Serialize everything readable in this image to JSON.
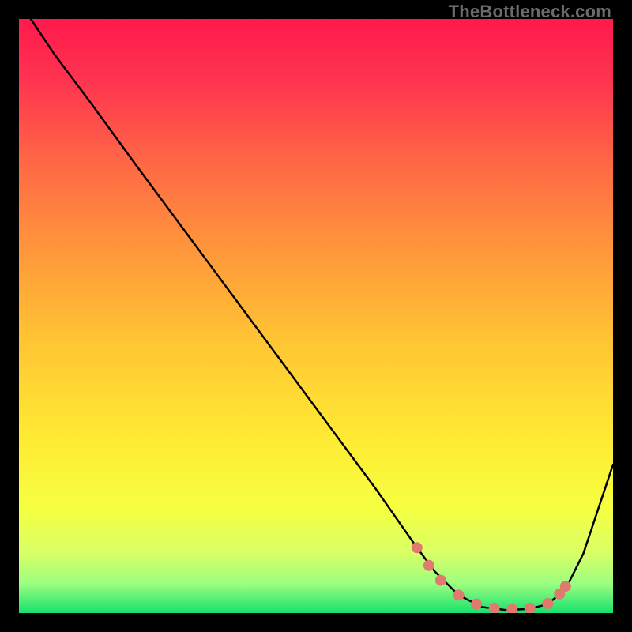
{
  "watermark": "TheBottleneck.com",
  "gradient": {
    "stops": [
      {
        "offset": "0%",
        "color": "#ff1a4d"
      },
      {
        "offset": "10%",
        "color": "#ff3350"
      },
      {
        "offset": "25%",
        "color": "#ff6a45"
      },
      {
        "offset": "40%",
        "color": "#ff9a3a"
      },
      {
        "offset": "55%",
        "color": "#ffc733"
      },
      {
        "offset": "70%",
        "color": "#ffe933"
      },
      {
        "offset": "82%",
        "color": "#f7ff40"
      },
      {
        "offset": "90%",
        "color": "#d8ff66"
      },
      {
        "offset": "95%",
        "color": "#9cff80"
      },
      {
        "offset": "100%",
        "color": "#18e06e"
      }
    ]
  },
  "chart_data": {
    "type": "line",
    "title": "",
    "xlabel": "",
    "ylabel": "",
    "xlim": [
      0,
      100
    ],
    "ylim": [
      0,
      100
    ],
    "series": [
      {
        "name": "curve",
        "x": [
          0,
          2,
          6,
          12,
          20,
          30,
          40,
          50,
          60,
          67,
          70,
          74,
          78,
          82,
          86,
          89,
          92,
          95,
          100
        ],
        "y": [
          104,
          100,
          94,
          86,
          75,
          61.5,
          48,
          34.5,
          21,
          11,
          7,
          3,
          1,
          0.5,
          0.7,
          1.5,
          4,
          10,
          25
        ]
      }
    ],
    "markers": {
      "name": "dots",
      "color": "#e07a6f",
      "points": [
        {
          "x": 67,
          "y": 11
        },
        {
          "x": 69,
          "y": 8
        },
        {
          "x": 71,
          "y": 5.5
        },
        {
          "x": 74,
          "y": 3
        },
        {
          "x": 77,
          "y": 1.5
        },
        {
          "x": 80,
          "y": 0.8
        },
        {
          "x": 83,
          "y": 0.6
        },
        {
          "x": 86,
          "y": 0.8
        },
        {
          "x": 89,
          "y": 1.6
        },
        {
          "x": 91,
          "y": 3.2
        },
        {
          "x": 92,
          "y": 4.5
        }
      ]
    }
  }
}
